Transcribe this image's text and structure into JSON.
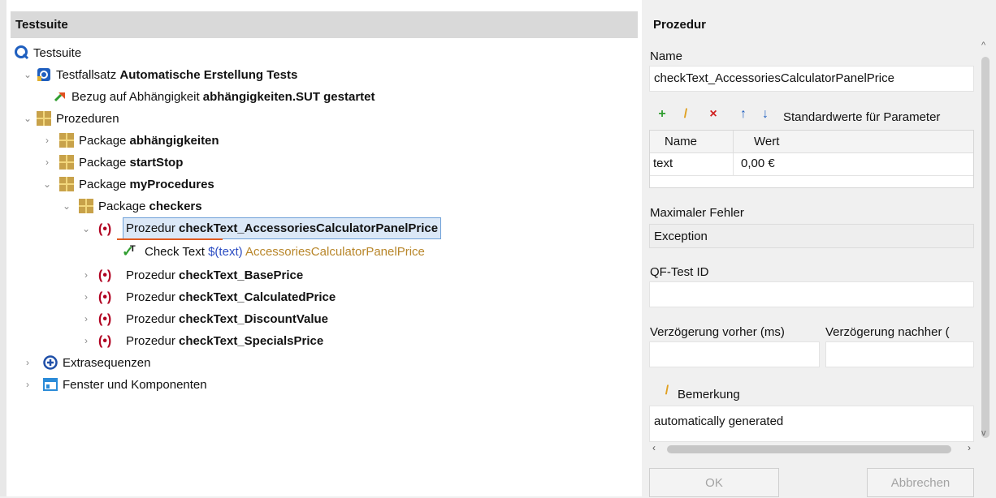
{
  "left": {
    "header": "Testsuite",
    "tree": [
      {
        "prefix": "",
        "bold": "",
        "plain": "Testsuite"
      },
      {
        "prefix": "Testfallsatz ",
        "bold": "Automatische Erstellung Tests"
      },
      {
        "prefix": "Bezug auf Abhängigkeit ",
        "bold": "abhängigkeiten.SUT gestartet"
      },
      {
        "prefix": "Prozeduren",
        "bold": ""
      },
      {
        "prefix": "Package ",
        "bold": "abhängigkeiten"
      },
      {
        "prefix": "Package ",
        "bold": "startStop"
      },
      {
        "prefix": "Package ",
        "bold": "myProcedures"
      },
      {
        "prefix": "Package ",
        "bold": "checkers"
      },
      {
        "prefix": "Prozedur ",
        "bold": "checkText_AccessoriesCalculatorPanelPrice"
      },
      {
        "prefix": "Check Text ",
        "param": "$(text)",
        "comp": " AccessoriesCalculatorPanelPrice"
      },
      {
        "prefix": "Prozedur ",
        "bold": "checkText_BasePrice"
      },
      {
        "prefix": "Prozedur ",
        "bold": "checkText_CalculatedPrice"
      },
      {
        "prefix": "Prozedur ",
        "bold": "checkText_DiscountValue"
      },
      {
        "prefix": "Prozedur ",
        "bold": "checkText_SpecialsPrice"
      },
      {
        "prefix": "Extrasequenzen",
        "bold": ""
      },
      {
        "prefix": "Fenster und Komponenten",
        "bold": ""
      }
    ]
  },
  "right": {
    "title": "Prozedur",
    "name_label": "Name",
    "name_value": "checkText_AccessoriesCalculatorPanelPrice",
    "toolbar_label": "Standardwerte für Parameter",
    "table": {
      "headers": [
        "Name",
        "Wert"
      ],
      "rows": [
        [
          "text",
          "0,00 €"
        ]
      ]
    },
    "max_error_label": "Maximaler Fehler",
    "max_error_value": "Exception",
    "id_label": "QF-Test ID",
    "id_value": "",
    "delay_before_label": "Verzögerung vorher (ms)",
    "delay_after_label": "Verzögerung nachher (",
    "remark_label": "Bemerkung",
    "remark_value": "automatically generated",
    "ok_label": "OK",
    "cancel_label": "Abbrechen"
  },
  "colors": {
    "accent": "#2b6cc4",
    "procedure": "#b00020",
    "parameter": "#2b4cc2",
    "component": "#b8862a"
  },
  "icons": [
    "testsuite-icon",
    "testset-icon",
    "dependency-ref-icon",
    "package-icon",
    "procedure-icon",
    "check-text-icon",
    "extras-icon",
    "window-components-icon",
    "add-icon",
    "edit-icon",
    "delete-icon",
    "move-up-icon",
    "move-down-icon"
  ]
}
